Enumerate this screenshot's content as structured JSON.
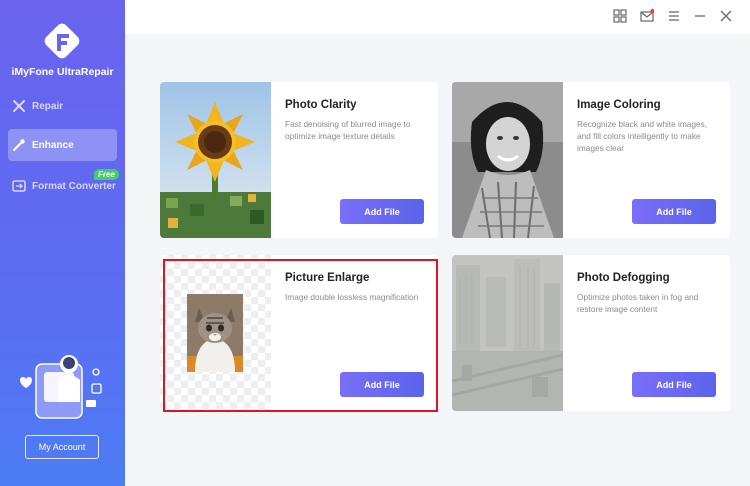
{
  "app": {
    "name": "iMyFone UltraRepair"
  },
  "sidebar": {
    "items": [
      {
        "label": "Repair",
        "icon": "tools-icon"
      },
      {
        "label": "Enhance",
        "icon": "magic-wand-icon",
        "active": true
      },
      {
        "label": "Format Converter",
        "icon": "convert-icon",
        "badge": "Free"
      }
    ],
    "account_label": "My Account"
  },
  "titlebar": {
    "icons": [
      "grid-icon",
      "mail-icon",
      "menu-icon",
      "minimize-icon",
      "close-icon"
    ]
  },
  "cards": [
    {
      "title": "Photo Clarity",
      "description": "Fast denoising of blurred image to optimize image texture details",
      "button": "Add File",
      "thumb": "sunflower"
    },
    {
      "title": "Image Coloring",
      "description": "Recognize black and white images, and fill colors intelligently to make images clear",
      "button": "Add File",
      "thumb": "bw-portrait"
    },
    {
      "title": "Picture Enlarge",
      "description": "Image double lossless magnification",
      "button": "Add File",
      "thumb": "cat",
      "highlighted": true
    },
    {
      "title": "Photo Defogging",
      "description": "Optimize photos taken in fog and restore image content",
      "button": "Add File",
      "thumb": "foggy-city"
    }
  ],
  "colors": {
    "accent": "#6a63ee",
    "highlight": "#e0141e",
    "free_badge": "#3dd06a"
  }
}
